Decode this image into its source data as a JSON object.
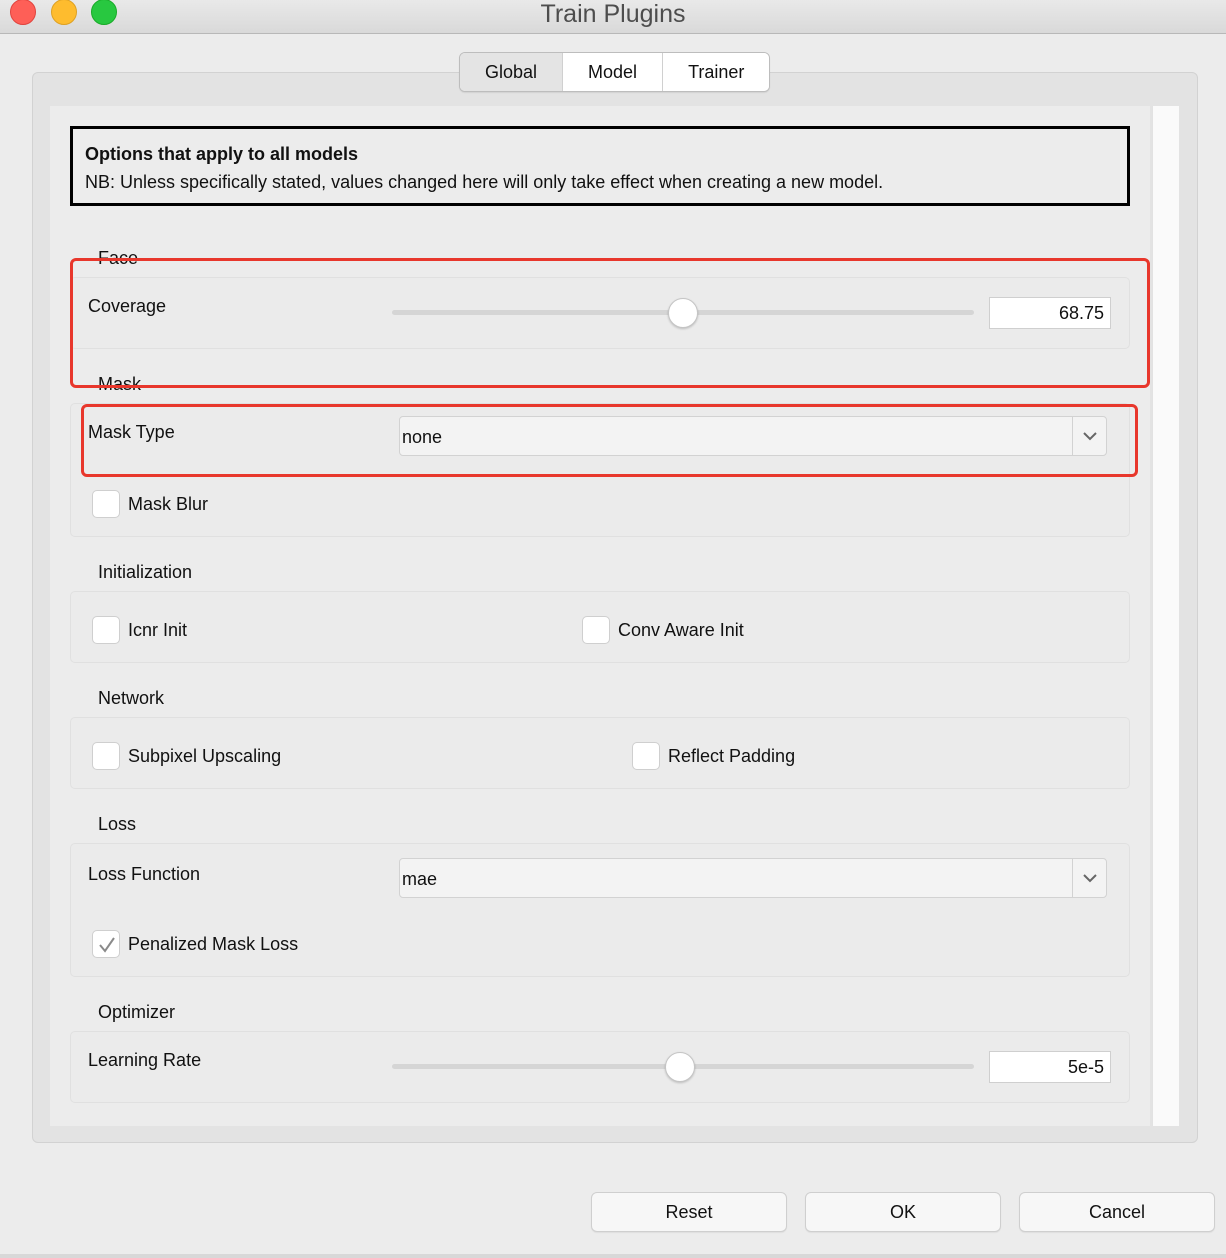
{
  "window": {
    "title": "Train Plugins"
  },
  "tabs": [
    {
      "label": "Global"
    },
    {
      "label": "Model"
    },
    {
      "label": "Trainer"
    }
  ],
  "info": {
    "heading": "Options that apply to all models",
    "note": "NB: Unless specifically stated, values changed here will only take effect when creating a new model."
  },
  "face": {
    "group_title": "Face",
    "coverage_label": "Coverage",
    "coverage_value": "68.75",
    "coverage_fraction": 0.5
  },
  "mask": {
    "group_title": "Mask",
    "mask_type_label": "Mask Type",
    "mask_type_value": "none",
    "mask_blur_label": "Mask Blur",
    "mask_blur_checked": false
  },
  "initialization": {
    "group_title": "Initialization",
    "icnr_label": "Icnr Init",
    "icnr_checked": false,
    "conv_aware_label": "Conv Aware Init",
    "conv_aware_checked": false
  },
  "network": {
    "group_title": "Network",
    "subpixel_label": "Subpixel Upscaling",
    "subpixel_checked": false,
    "reflect_label": "Reflect Padding",
    "reflect_checked": false
  },
  "loss": {
    "group_title": "Loss",
    "loss_function_label": "Loss Function",
    "loss_function_value": "mae",
    "penalized_label": "Penalized Mask Loss",
    "penalized_checked": true
  },
  "optimizer": {
    "group_title": "Optimizer",
    "learning_rate_label": "Learning Rate",
    "learning_rate_value": "5e-5",
    "learning_rate_fraction": 0.495
  },
  "buttons": {
    "reset": "Reset",
    "ok": "OK",
    "cancel": "Cancel"
  },
  "colors": {
    "highlight": "#e8372c",
    "close": "#fe5f57",
    "minimize": "#febc2e",
    "zoom": "#28c840"
  }
}
